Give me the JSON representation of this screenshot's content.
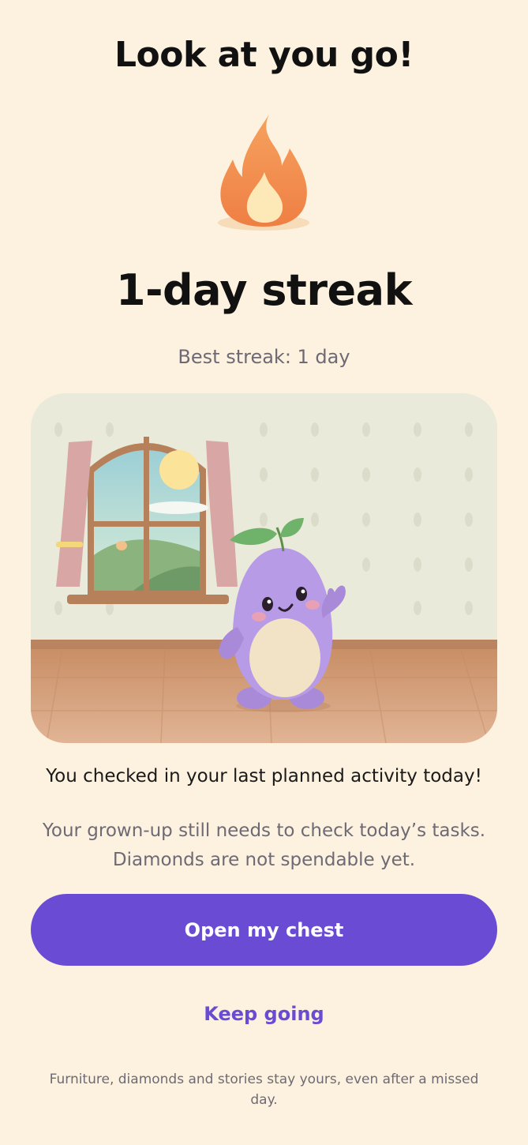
{
  "header": {
    "title": "Look at you go!"
  },
  "flame": {
    "icon": "flame-icon",
    "colors": {
      "outer": "#f08a4b",
      "inner": "#fde9b8",
      "shadow": "#f6dcb8"
    }
  },
  "streak": {
    "title": "1-day streak",
    "best": "Best streak: 1 day"
  },
  "scene": {
    "illustration": "room-with-mascot",
    "colors": {
      "wall": "#eaeadb",
      "floor": "#d7a27c",
      "curtain": "#d8a6a4",
      "window_frame": "#b6805a",
      "mascot": "#b79be6",
      "leaf": "#6fb36a"
    }
  },
  "message": {
    "text": "You checked in your last planned activity today!",
    "note_line1": "Your grown-up still needs to check today’s tasks.",
    "note_line2": "Diamonds are not spendable yet."
  },
  "actions": {
    "primary_label": "Open my chest",
    "secondary_label": "Keep going",
    "accent": "#6a4bd4"
  },
  "footer": {
    "text": "Furniture, diamonds and stories stay yours, even after a missed day."
  }
}
